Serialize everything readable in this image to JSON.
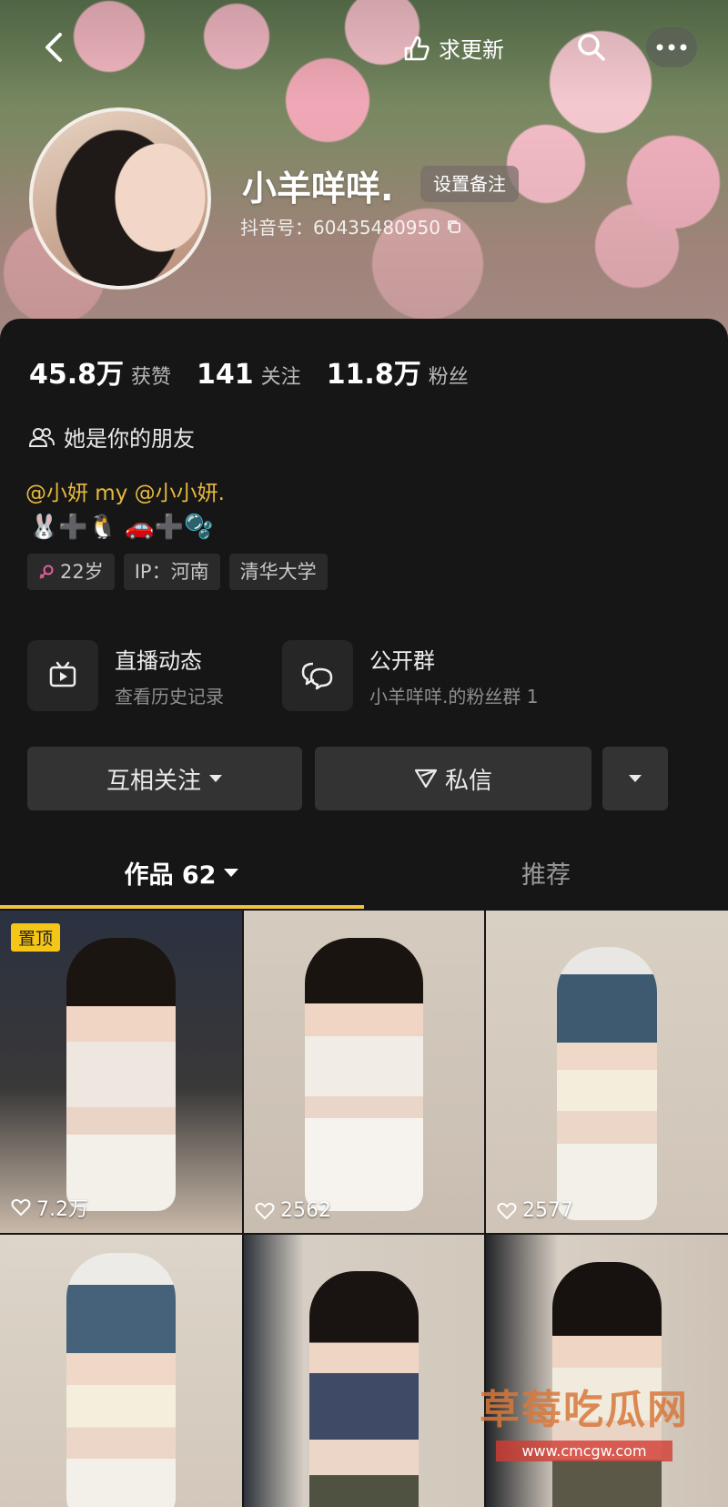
{
  "header": {
    "update_label": "求更新"
  },
  "profile": {
    "nickname": "小羊咩咩.",
    "remark_button": "设置备注",
    "douyin_id": "抖音号：60435480950"
  },
  "stats": [
    {
      "value": "45.8万",
      "label": "获赞"
    },
    {
      "value": "141",
      "label": "关注"
    },
    {
      "value": "11.8万",
      "label": "粉丝"
    }
  ],
  "friend_text": "她是你的朋友",
  "mentions": "@小妍 my @小小妍.",
  "emoji_line": "🐰➕🐧    🚗➕🫧",
  "tags": [
    {
      "label": "22岁",
      "icon": "female-icon"
    },
    {
      "label": "IP：河南"
    },
    {
      "label": "清华大学"
    }
  ],
  "cards": [
    {
      "title": "直播动态",
      "subtitle": "查看历史记录",
      "icon": "tv-icon"
    },
    {
      "title": "公开群",
      "subtitle": "小羊咩咩.的粉丝群 1",
      "icon": "chat-icon"
    }
  ],
  "actions": {
    "follow_label": "互相关注",
    "message_label": "私信"
  },
  "tabs": {
    "works_label": "作品 62",
    "recommend_label": "推荐"
  },
  "videos": [
    {
      "likes": "7.2万",
      "badge": "置顶"
    },
    {
      "likes": "2562"
    },
    {
      "likes": "2577"
    },
    {
      "likes": ""
    },
    {
      "likes": ""
    },
    {
      "likes": ""
    }
  ],
  "watermark": {
    "title": "草莓吃瓜网",
    "url": "www.cmcgw.com"
  },
  "colors": {
    "accent": "#f2c23d",
    "background": "#161616",
    "mention": "#e8b940"
  }
}
